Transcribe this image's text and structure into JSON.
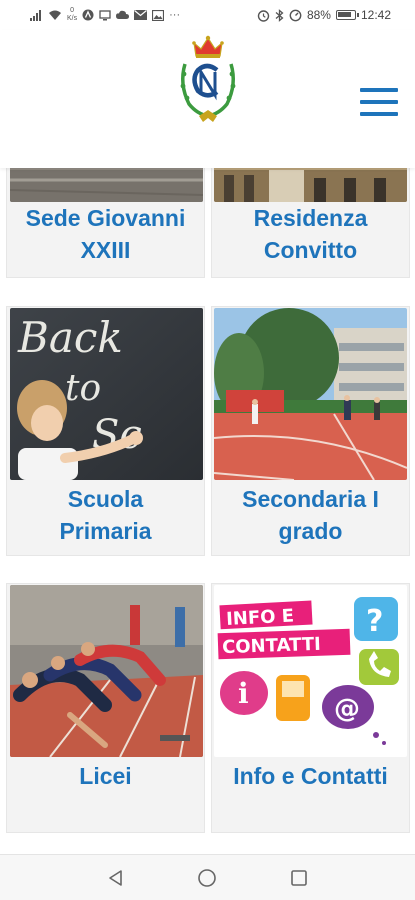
{
  "status_bar": {
    "left_icons": [
      "signal-icon",
      "wifi-icon",
      "data-speed-icon",
      "app-icon",
      "screen-icon",
      "cloud-icon",
      "mail-icon",
      "image-icon",
      "more-icon"
    ],
    "speed_top": "0",
    "speed_unit": "K/s",
    "more": "···",
    "battery": "88%",
    "time": "12:42"
  },
  "header": {
    "logo_icon": "school-crest-logo",
    "menu_icon": "hamburger-menu-icon"
  },
  "cards": [
    {
      "label_line1": "Sede Giovanni",
      "label_line2": "XXIII"
    },
    {
      "label_line1": "Residenza",
      "label_line2": "Convitto"
    },
    {
      "label_line1": "Scuola",
      "label_line2": "Primaria"
    },
    {
      "label_line1": "Secondaria I",
      "label_line2": "grado"
    },
    {
      "label_line1": "Licei",
      "label_line2": ""
    },
    {
      "label_line1": "Info e Contatti",
      "label_line2": ""
    }
  ],
  "images": {
    "chalkboard": {
      "line1": "Back",
      "line2": "to",
      "line3": "Sc"
    },
    "info": {
      "line1": "INFO E",
      "line2": "CONTATTI"
    }
  },
  "colors": {
    "accent": "#1e74bb",
    "card_bg": "#f3f3f3",
    "info_pink": "#e8207a"
  },
  "nav_bar": {
    "back_icon": "back-triangle-icon",
    "home_icon": "home-circle-icon",
    "recents_icon": "recents-square-icon"
  }
}
